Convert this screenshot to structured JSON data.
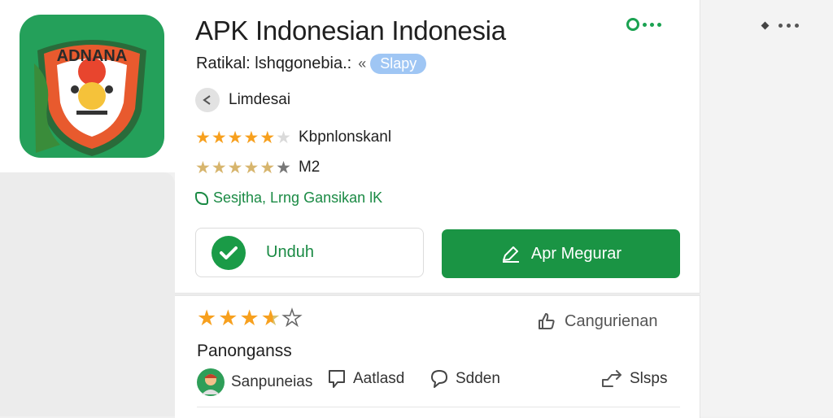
{
  "app": {
    "title": "APK Indonesian Indonesia",
    "icon_text": "ADNANA",
    "icon": "shield-emblem-icon"
  },
  "developer": {
    "text": "Ratikal: lshqgonebia.:",
    "chevron": "«",
    "pill": "Slapy"
  },
  "category": {
    "label": "Limdesai",
    "icon": "share-icon"
  },
  "ratings": [
    {
      "label": "Kbpnlonskanl",
      "stars": 5,
      "filled": 5
    },
    {
      "label": "M2",
      "stars": 5,
      "filled": 4
    }
  ],
  "safety": {
    "label": "Sesjtha, Lrng Gansikan lK",
    "icon": "leaf-shield-icon"
  },
  "buttons": {
    "download": "Unduh",
    "open": "Apr Megurar"
  },
  "review": {
    "stars": 3.5,
    "title": "Panonganss",
    "like_label": "Cangurienan"
  },
  "actions": {
    "user": "Sanpuneias",
    "comment": "Aatlasd",
    "reply": "Sdden",
    "share": "Slsps"
  },
  "colors": {
    "accent_green": "#1a9444",
    "star_orange": "#f7a01e",
    "pill_blue": "#9fc6f4"
  }
}
